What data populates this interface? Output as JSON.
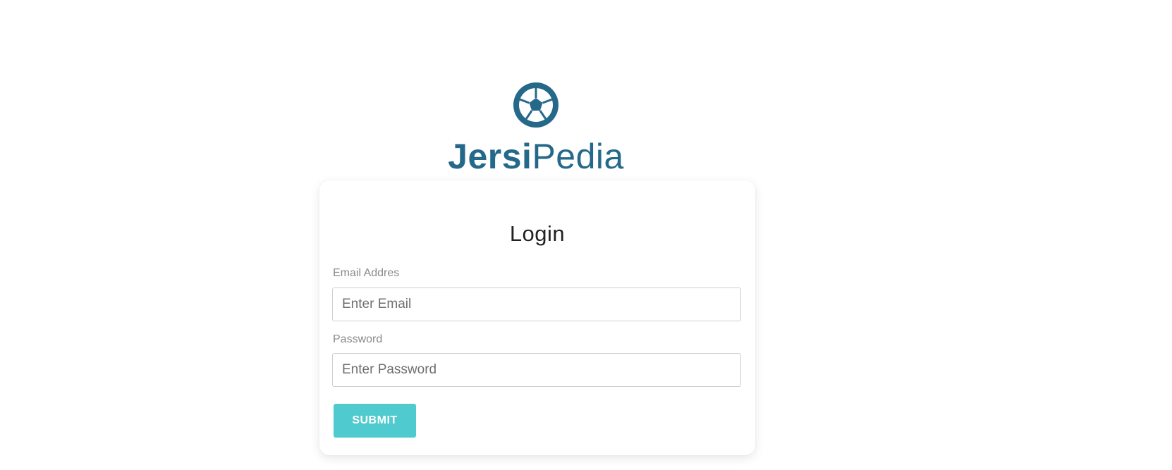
{
  "brand": {
    "name_bold": "Jersi",
    "name_light": "Pedia",
    "logo_icon": "soccer-ball-icon",
    "color": "#25698a"
  },
  "login": {
    "title": "Login",
    "email": {
      "label": "Email Addres",
      "placeholder": "Enter Email",
      "value": ""
    },
    "password": {
      "label": "Password",
      "placeholder": "Enter Password",
      "value": ""
    },
    "submit_label": "SUBMIT",
    "submit_color": "#4fcbd0"
  }
}
